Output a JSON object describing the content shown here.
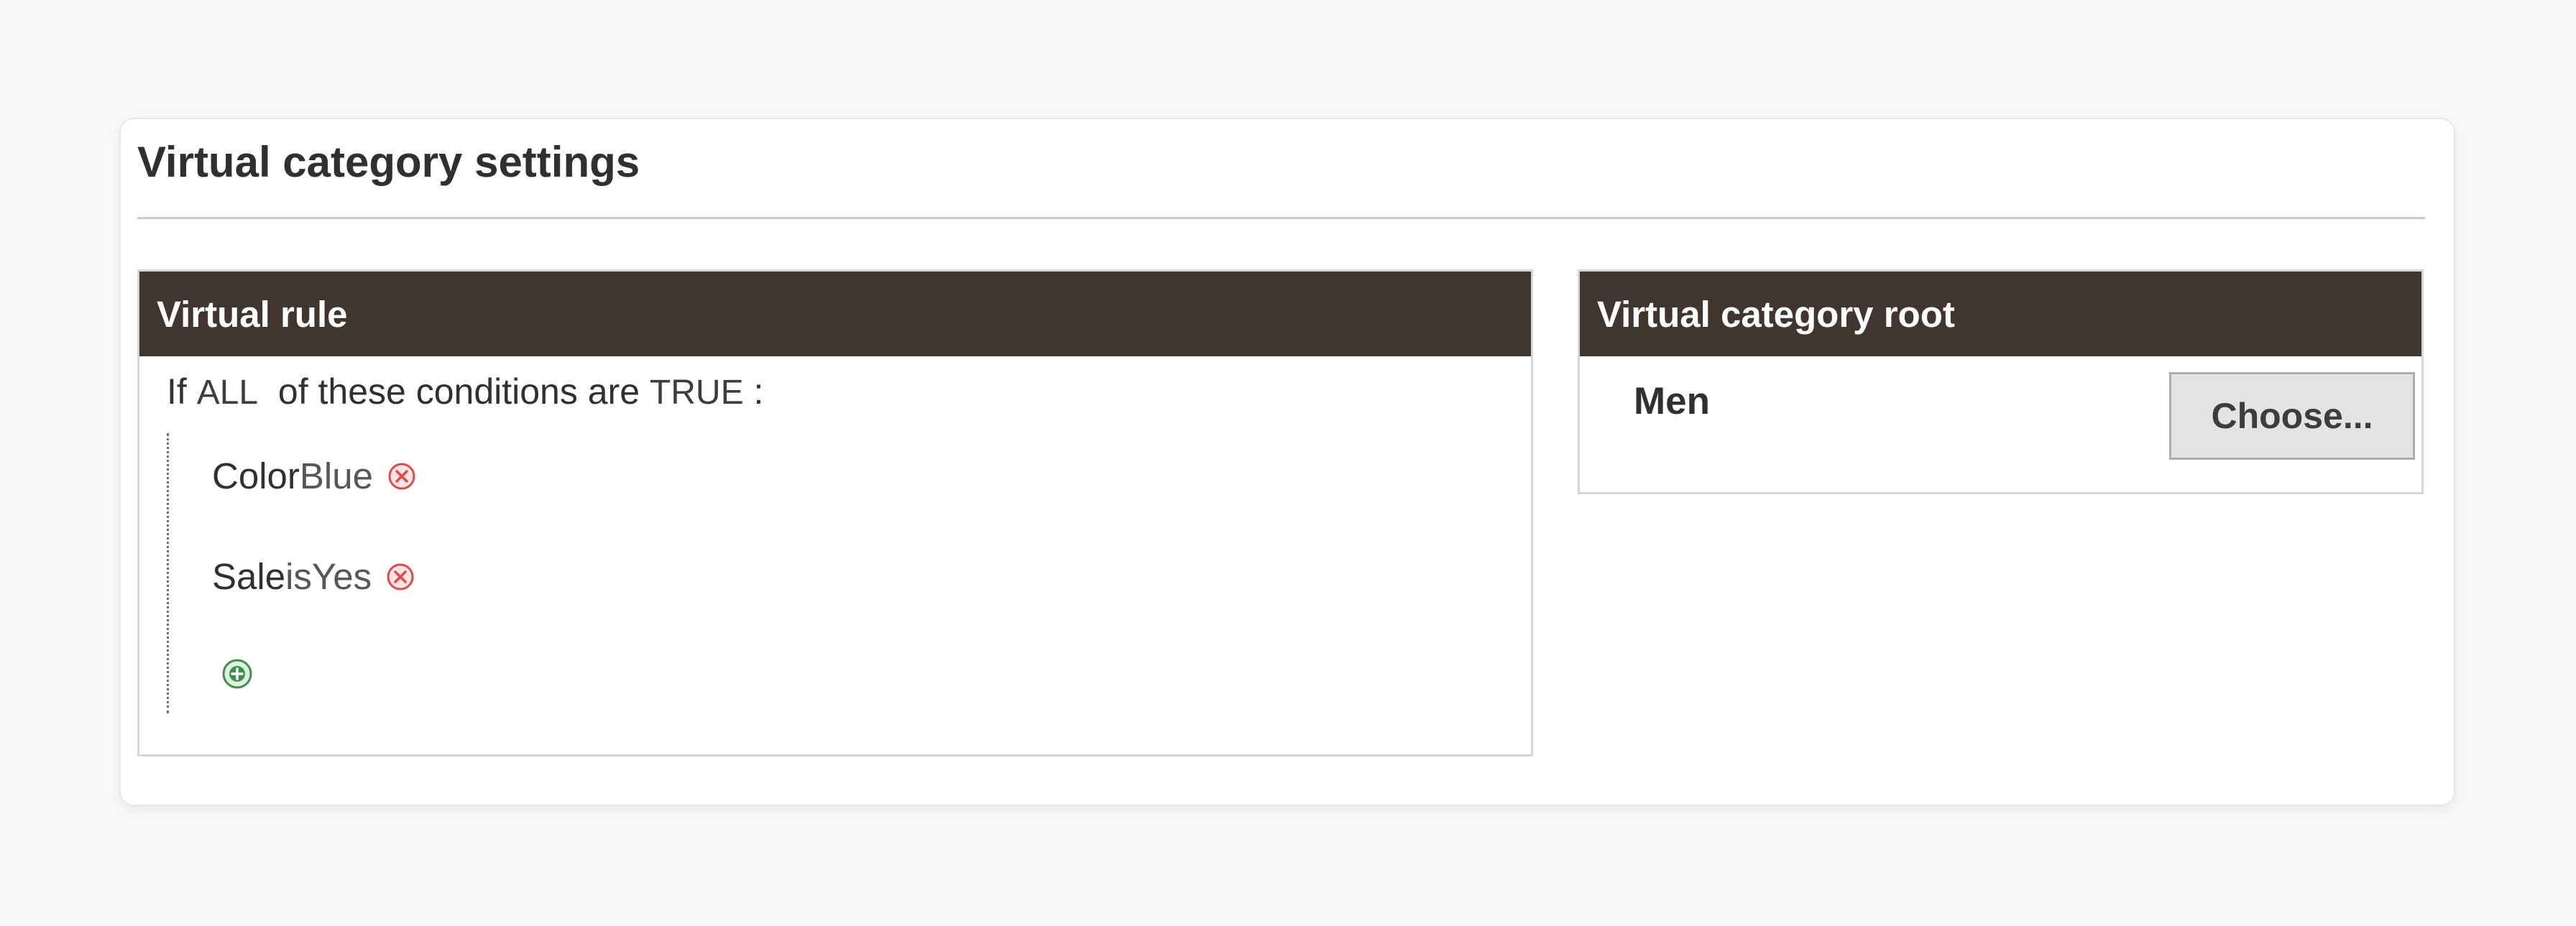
{
  "section": {
    "title": "Virtual category settings"
  },
  "virtual_rule": {
    "header": "Virtual rule",
    "intro": {
      "prefix": "If",
      "aggregator": "ALL",
      "middle": "of these conditions are",
      "value": "TRUE",
      "suffix": ":"
    },
    "conditions": [
      {
        "attribute": "Color",
        "operator": "",
        "value": "Blue",
        "remove_icon": "remove-circle-icon"
      },
      {
        "attribute": "Sale",
        "operator": "is",
        "value": "Yes",
        "remove_icon": "remove-circle-icon"
      }
    ],
    "add_icon": "add-circle-icon"
  },
  "virtual_category_root": {
    "header": "Virtual category root",
    "value": "Men",
    "choose_label": "Choose..."
  },
  "colors": {
    "panel_header_bg": "#41362f",
    "remove_icon": "#e04a4a",
    "add_icon": "#3f8f4f"
  }
}
